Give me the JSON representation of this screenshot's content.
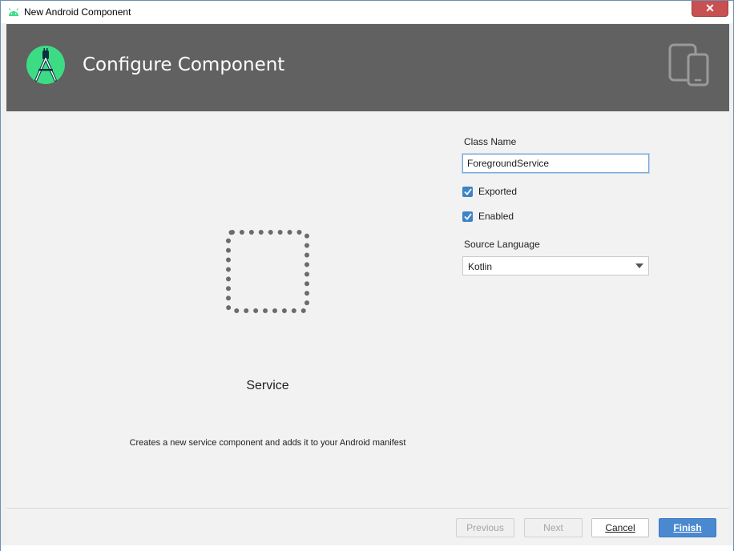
{
  "window": {
    "title": "New Android Component",
    "close_label": "✕"
  },
  "header": {
    "heading": "Configure Component",
    "accent_color": "#3ddc84",
    "band_color": "#616161"
  },
  "preview": {
    "component_name": "Service",
    "description": "Creates a new service component and adds it to your Android manifest"
  },
  "form": {
    "class_name_label": "Class Name",
    "class_name_value": "ForegroundService",
    "exported_label": "Exported",
    "exported_checked": true,
    "enabled_label": "Enabled",
    "enabled_checked": true,
    "source_language_label": "Source Language",
    "source_language_value": "Kotlin"
  },
  "footer": {
    "previous_label": "Previous",
    "next_label": "Next",
    "cancel_label": "Cancel",
    "finish_label": "Finish"
  },
  "icons": [
    "android-icon",
    "android-studio-logo-icon",
    "devices-icon",
    "close-icon",
    "checkbox-checked-icon",
    "chevron-down-icon"
  ]
}
